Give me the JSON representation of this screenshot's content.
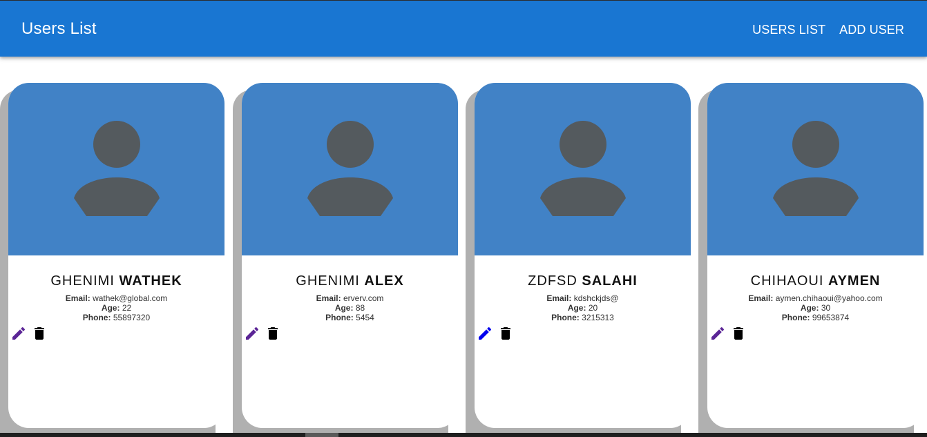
{
  "app": {
    "title": "Users List",
    "nav": [
      "USERS LIST",
      "ADD USER"
    ]
  },
  "colors": {
    "appbar": "#1976d2",
    "card_media": "#4182c6",
    "avatar": "#545a5e",
    "edit_icon": "#5b2596",
    "edit_icon_active": "#0000ee",
    "delete_icon": "#000000"
  },
  "labels": {
    "email": "Email:",
    "age": "Age:",
    "phone": "Phone:"
  },
  "users": [
    {
      "first": "GHENIMI",
      "last": "WATHEK",
      "email": "wathek@global.com",
      "age": "22",
      "phone": "55897320",
      "avatar_icon": "person-icon",
      "edit_icon": "pencil-icon",
      "delete_icon": "trash-icon"
    },
    {
      "first": "GHENIMI",
      "last": "ALEX",
      "email": "erverv.com",
      "age": "88",
      "phone": "5454",
      "avatar_icon": "person-icon",
      "edit_icon": "pencil-icon",
      "delete_icon": "trash-icon"
    },
    {
      "first": "ZDFSD",
      "last": "SALAHI",
      "email": "kdshckjds@",
      "age": "20",
      "phone": "3215313",
      "avatar_icon": "person-icon",
      "edit_icon": "pencil-icon",
      "delete_icon": "trash-icon"
    },
    {
      "first": "CHIHAOUI",
      "last": "AYMEN",
      "email": "aymen.chihaoui@yahoo.com",
      "age": "30",
      "phone": "99653874",
      "avatar_icon": "person-icon",
      "edit_icon": "pencil-icon",
      "delete_icon": "trash-icon"
    }
  ]
}
